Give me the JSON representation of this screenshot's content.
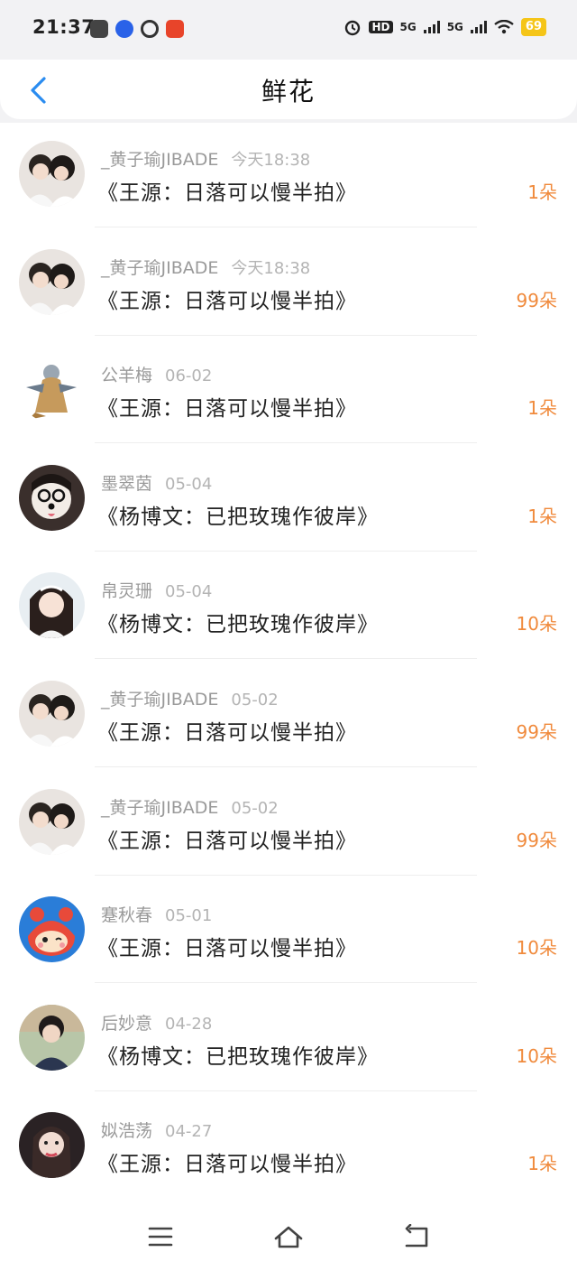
{
  "status_bar": {
    "time": "21:37",
    "hd_label": "HD",
    "net1": "5G",
    "net2": "5G",
    "battery": "69"
  },
  "header": {
    "title": "鲜花",
    "back_icon": "chevron-left-icon"
  },
  "records": [
    {
      "name": "_黄子瑜JIBADE",
      "date": "今天18:38",
      "title": "《王源：日落可以慢半拍》",
      "count": "1朵"
    },
    {
      "name": "_黄子瑜JIBADE",
      "date": "今天18:38",
      "title": "《王源：日落可以慢半拍》",
      "count": "99朵"
    },
    {
      "name": "公羊梅",
      "date": "06-02",
      "title": "《王源：日落可以慢半拍》",
      "count": "1朵"
    },
    {
      "name": "墨翠茵",
      "date": "05-04",
      "title": "《杨博文：已把玫瑰作彼岸》",
      "count": "1朵"
    },
    {
      "name": "帛灵珊",
      "date": "05-04",
      "title": "《杨博文：已把玫瑰作彼岸》",
      "count": "10朵"
    },
    {
      "name": "_黄子瑜JIBADE",
      "date": "05-02",
      "title": "《王源：日落可以慢半拍》",
      "count": "99朵"
    },
    {
      "name": "_黄子瑜JIBADE",
      "date": "05-02",
      "title": "《王源：日落可以慢半拍》",
      "count": "99朵"
    },
    {
      "name": "蹇秋春",
      "date": "05-01",
      "title": "《王源：日落可以慢半拍》",
      "count": "10朵"
    },
    {
      "name": "后妙意",
      "date": "04-28",
      "title": "《杨博文：已把玫瑰作彼岸》",
      "count": "10朵"
    },
    {
      "name": "姒浩荡",
      "date": "04-27",
      "title": "《王源：日落可以慢半拍》",
      "count": "1朵"
    }
  ],
  "colors": {
    "accent_blue": "#2a8cf0",
    "count_orange": "#f08a3c"
  },
  "bottom_nav": {
    "menu_icon": "menu-icon",
    "home_icon": "home-icon",
    "back_icon": "back-return-icon"
  }
}
